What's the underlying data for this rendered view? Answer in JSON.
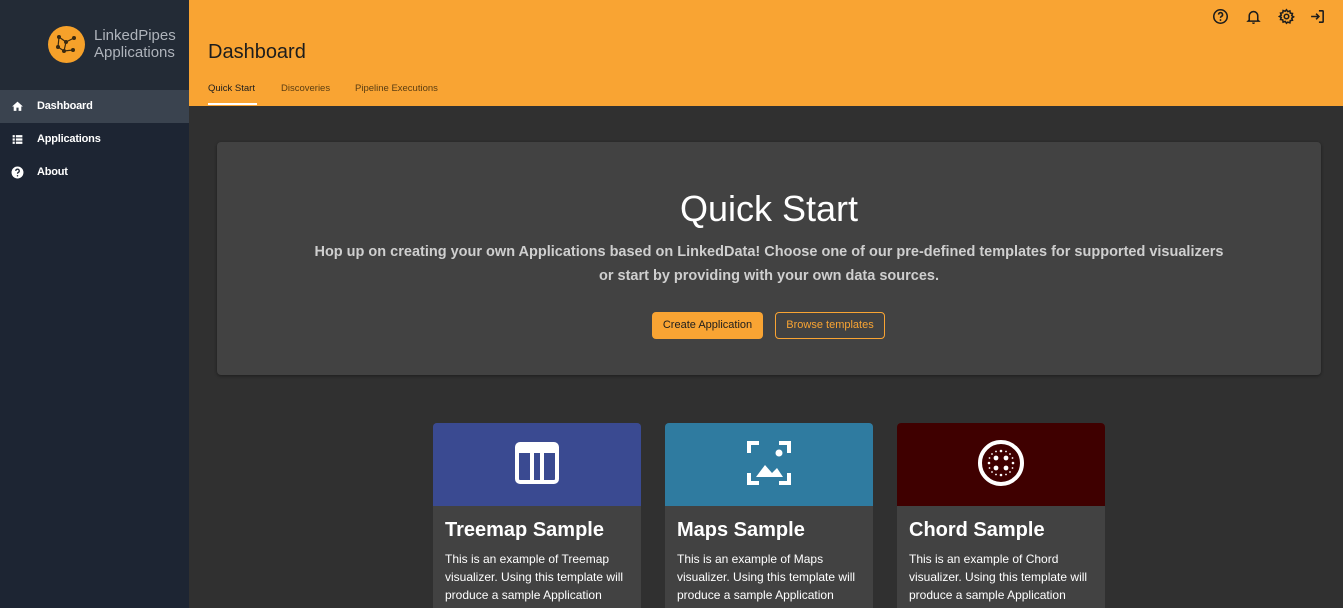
{
  "brand": {
    "line1": "LinkedPipes",
    "line2": "Applications",
    "accent": "#f9a433"
  },
  "sidebar": {
    "items": [
      {
        "label": "Dashboard",
        "icon": "home-icon",
        "active": true
      },
      {
        "label": "Applications",
        "icon": "list-icon",
        "active": false
      },
      {
        "label": "About",
        "icon": "help-icon",
        "active": false
      }
    ]
  },
  "header": {
    "title": "Dashboard",
    "tabs": [
      {
        "label": "Quick Start",
        "active": true
      },
      {
        "label": "Discoveries",
        "active": false
      },
      {
        "label": "Pipeline Executions",
        "active": false
      }
    ],
    "icons": [
      "help-icon",
      "bell-icon",
      "settings-icon",
      "logout-icon"
    ]
  },
  "hero": {
    "title": "Quick Start",
    "description": "Hop up on creating your own Applications based on LinkedData! Choose one of our pre-defined templates for supported visualizers or start by providing with your own data sources.",
    "primary_button": "Create Application",
    "secondary_button": "Browse templates"
  },
  "cards": [
    {
      "title": "Treemap Sample",
      "text": "This is an example of Treemap visualizer. Using this template will produce a sample Application",
      "color": "#3a4a91",
      "icon": "table-icon"
    },
    {
      "title": "Maps Sample",
      "text": "This is an example of Maps visualizer. Using this template will produce a sample Application",
      "color": "#2f7ba0",
      "icon": "image-icon"
    },
    {
      "title": "Chord Sample",
      "text": "This is an example of Chord visualizer. Using this template will produce a sample Application",
      "color": "#3f0000",
      "icon": "chord-icon"
    }
  ]
}
